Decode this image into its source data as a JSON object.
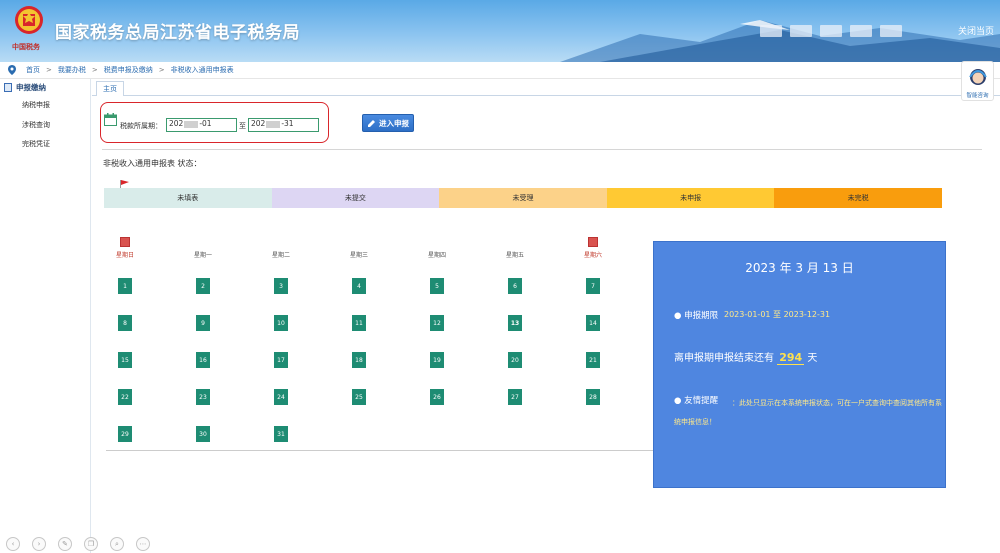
{
  "header": {
    "title": "国家税务总局江苏省电子税务局",
    "emblem_caption": "中国税务",
    "close_page": "关闭当页"
  },
  "breadcrumb": [
    "首页",
    "我要办税",
    "税费申报及缴纳",
    "非税收入通用申报表"
  ],
  "sidebar": {
    "group": "申报缴纳",
    "items": [
      "纳税申报",
      "涉税查询",
      "完税凭证"
    ]
  },
  "tabs": {
    "home": "主页"
  },
  "assistant": {
    "label": "智能咨询"
  },
  "period": {
    "label": "税款所属期：",
    "from_value": "202",
    "from_suffix": "-01",
    "to_label": "至",
    "to_value": "202",
    "to_suffix": "-31"
  },
  "enter_button": "进入申报",
  "status": {
    "title": "非税收入通用申报表 状态：",
    "segments": [
      {
        "label": "未填表",
        "color": "#d9ecea"
      },
      {
        "label": "未提交",
        "color": "#ddd6f3"
      },
      {
        "label": "未受理",
        "color": "#fcd289"
      },
      {
        "label": "未申报",
        "color": "#ffc933"
      },
      {
        "label": "未完税",
        "color": "#f99d0d"
      }
    ]
  },
  "calendar": {
    "weekdays": [
      "星期日",
      "星期一",
      "星期二",
      "星期三",
      "星期四",
      "星期五",
      "星期六"
    ],
    "today": 13,
    "days": [
      1,
      2,
      3,
      4,
      5,
      6,
      7,
      8,
      9,
      10,
      11,
      12,
      13,
      14,
      15,
      16,
      17,
      18,
      19,
      20,
      21,
      22,
      23,
      24,
      25,
      26,
      27,
      28,
      29,
      30,
      31
    ]
  },
  "info": {
    "date": "2023 年 3 月 13 日",
    "period_label": "● 申报期限",
    "period_value": "2023-01-01 至 2023-12-31",
    "remaining_prefix": "离申报期申报结束还有",
    "remaining_days": "294",
    "remaining_suffix": "天",
    "tip_label": "● 友情提醒",
    "tip_text": "：此处只显示在本系统申报状态，可在一户式查询中查阅其他所有系统申报信息！"
  }
}
